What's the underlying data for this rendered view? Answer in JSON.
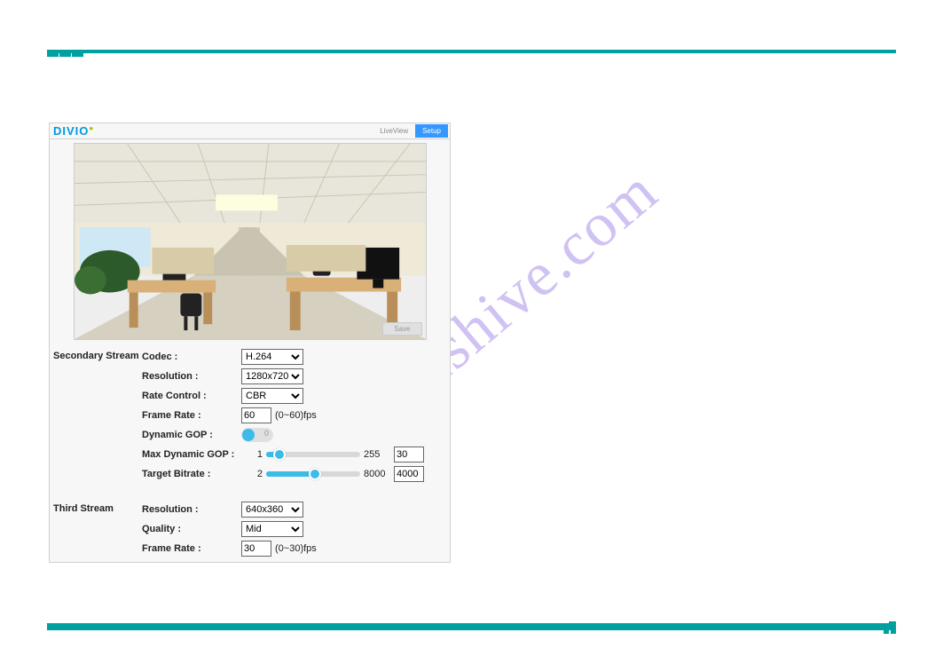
{
  "watermark": "manualshive.com",
  "app": {
    "logo": "DIVIO",
    "tabs": {
      "liveview": "LiveView",
      "setup": "Setup"
    },
    "save": "Save"
  },
  "secondary": {
    "group": "Secondary Stream",
    "codec_label": "Codec :",
    "codec_value": "H.264",
    "resolution_label": "Resolution :",
    "resolution_value": "1280x720",
    "ratecontrol_label": "Rate Control :",
    "ratecontrol_value": "CBR",
    "framerate_label": "Frame Rate :",
    "framerate_value": "60",
    "framerate_unit": "(0~60)fps",
    "dyngop_label": "Dynamic GOP :",
    "dyngop_value": "0",
    "maxdyngop_label": "Max Dynamic GOP :",
    "maxdyngop_min": "1",
    "maxdyngop_max": "255",
    "maxdyngop_value": "30",
    "bitrate_label": "Target Bitrate :",
    "bitrate_min": "2",
    "bitrate_max": "8000",
    "bitrate_value": "4000"
  },
  "third": {
    "group": "Third Stream",
    "resolution_label": "Resolution :",
    "resolution_value": "640x360",
    "quality_label": "Quality :",
    "quality_value": "Mid",
    "framerate_label": "Frame Rate :",
    "framerate_value": "30",
    "framerate_unit": "(0~30)fps"
  }
}
